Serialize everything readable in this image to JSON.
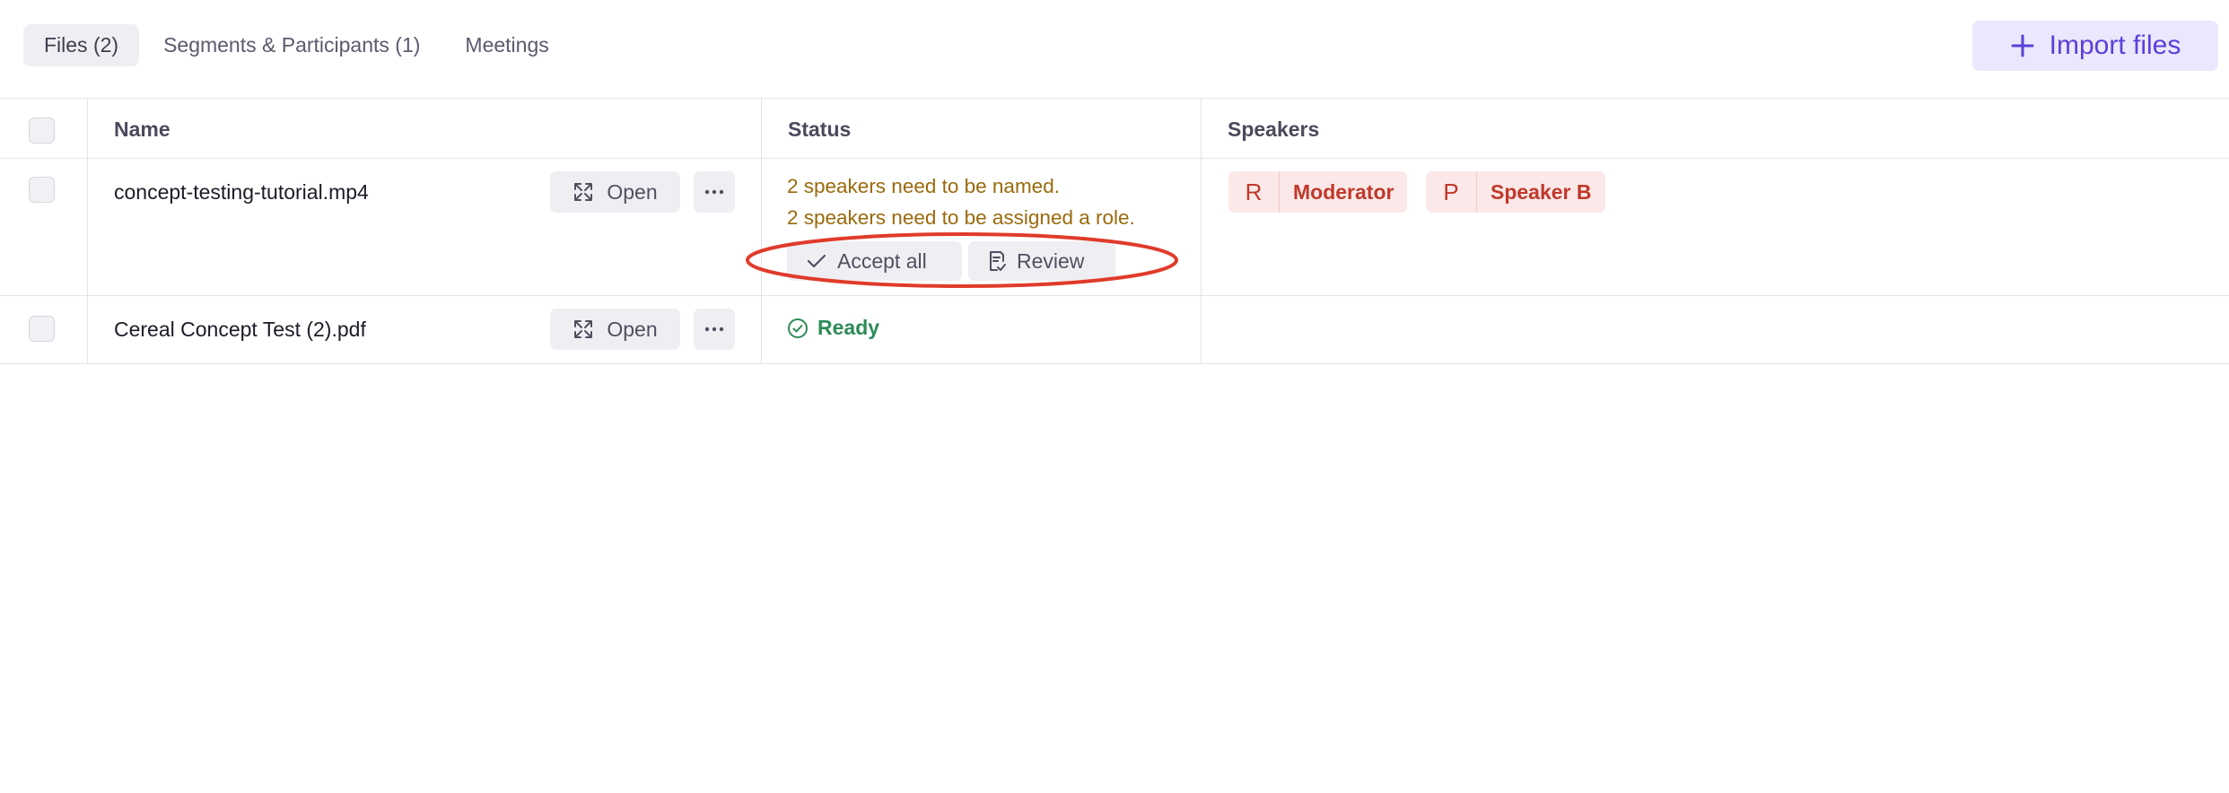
{
  "tabs": [
    {
      "label": "Files (2)",
      "active": true
    },
    {
      "label": "Segments & Participants (1)",
      "active": false
    },
    {
      "label": "Meetings",
      "active": false
    }
  ],
  "import_button": {
    "label": "Import files",
    "icon": "plus-icon",
    "color": "#5b3fd9"
  },
  "table": {
    "columns": [
      "Name",
      "Status",
      "Speakers"
    ],
    "rows": [
      {
        "name": "concept-testing-tutorial.mp4",
        "open_label": "Open",
        "status_lines": [
          "2 speakers need to be named.",
          "2 speakers need to be assigned a role."
        ],
        "actions": [
          "Accept all",
          "Review"
        ],
        "speakers": [
          {
            "letter": "R",
            "label": "Moderator"
          },
          {
            "letter": "P",
            "label": "Speaker B"
          }
        ]
      },
      {
        "name": "Cereal Concept Test (2).pdf",
        "open_label": "Open",
        "status": "Ready",
        "status_color": "#2e8b57"
      }
    ]
  },
  "colors": {
    "accent": "#5b3fd9",
    "warning": "#9a6a0c",
    "speaker_chip": "#c0392b",
    "annotation": "#e03b2b"
  }
}
